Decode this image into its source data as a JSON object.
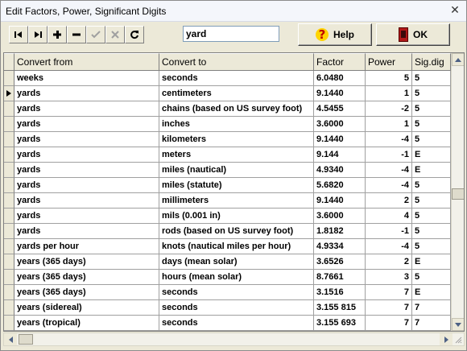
{
  "window": {
    "title": "Edit Factors, Power, Significant Digits",
    "close_glyph": "✕"
  },
  "toolbar": {
    "nav_buttons": [
      "first-record-icon",
      "last-record-icon",
      "add-record-icon",
      "delete-record-icon",
      "post-edit-icon",
      "cancel-edit-icon",
      "refresh-icon"
    ],
    "search_value": "yard",
    "help_label": "Help",
    "help_icon": "?",
    "ok_label": "OK"
  },
  "table": {
    "columns": [
      "Convert from",
      "Convert to",
      "Factor",
      "Power",
      "Sig.dig"
    ],
    "current_row_index": 1,
    "rows": [
      [
        "weeks",
        "seconds",
        "6.0480",
        "5",
        "5"
      ],
      [
        "yards",
        "centimeters",
        "9.1440",
        "1",
        "5"
      ],
      [
        "yards",
        "chains (based on US survey foot)",
        "4.5455",
        "-2",
        "5"
      ],
      [
        "yards",
        "inches",
        "3.6000",
        "1",
        "5"
      ],
      [
        "yards",
        "kilometers",
        "9.1440",
        "-4",
        "5"
      ],
      [
        "yards",
        "meters",
        "9.144",
        "-1",
        "E"
      ],
      [
        "yards",
        "miles (nautical)",
        "4.9340",
        "-4",
        "E"
      ],
      [
        "yards",
        "miles (statute)",
        "5.6820",
        "-4",
        "5"
      ],
      [
        "yards",
        "millimeters",
        "9.1440",
        "2",
        "5"
      ],
      [
        "yards",
        "mils (0.001 in)",
        "3.6000",
        "4",
        "5"
      ],
      [
        "yards",
        "rods (based on US survey foot)",
        "1.8182",
        "-1",
        "5"
      ],
      [
        "yards per hour",
        "knots (nautical miles per hour)",
        "4.9334",
        "-4",
        "5"
      ],
      [
        "years (365 days)",
        "days (mean solar)",
        "3.6526",
        "2",
        "E"
      ],
      [
        "years (365 days)",
        "hours (mean solar)",
        "8.7661",
        "3",
        "5"
      ],
      [
        "years (365 days)",
        "seconds",
        "3.1516",
        "7",
        "E"
      ],
      [
        "years (sidereal)",
        "seconds",
        "3.155 815",
        "7",
        "7"
      ],
      [
        "years (tropical)",
        "seconds",
        "3.155 693",
        "7",
        "7"
      ]
    ]
  },
  "colors": {
    "chrome": "#ece9d8",
    "grid_line": "#a0a0a0",
    "help_icon": "#c00000",
    "ok_icon": "#b01818"
  }
}
